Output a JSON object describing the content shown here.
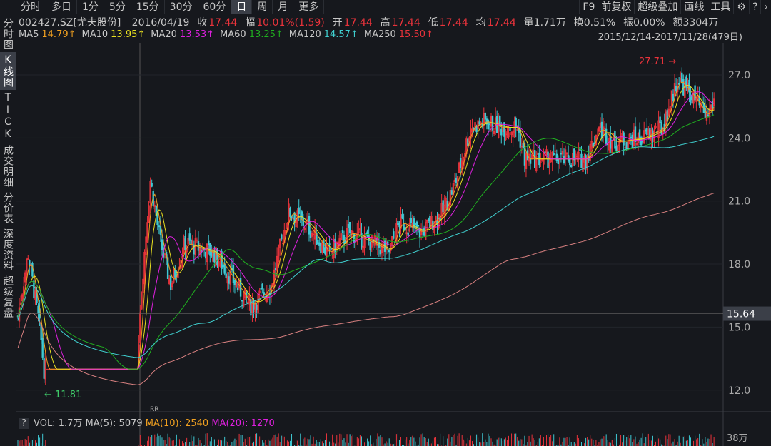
{
  "periods": [
    "分时",
    "多日",
    "1分",
    "5分",
    "15分",
    "30分",
    "60分",
    "日",
    "周",
    "月",
    "更多"
  ],
  "active_period": "日",
  "tools": [
    "F9",
    "前复权",
    "超级叠加",
    "画线",
    "工具",
    "⚙",
    "?",
    "›"
  ],
  "sidebar": [
    "分时图",
    "K线图",
    "TICK",
    "成交明细",
    "分价表",
    "深度资料",
    "超级复盘"
  ],
  "info": {
    "code": "002427.SZ[尤夫股份]",
    "date": "2016/04/19",
    "close_l": "收",
    "close": "17.44",
    "amp_l": "幅",
    "amp": "10.01%(1.59)",
    "open_l": "开",
    "open": "17.44",
    "high_l": "高",
    "high": "17.44",
    "low_l": "低",
    "low": "17.44",
    "avg_l": "均",
    "avg": "17.44",
    "vol": "量1.71万",
    "turn": "换0.51%",
    "swing": "振0.00%",
    "amount": "额3304万"
  },
  "ma": [
    {
      "l": "MA5",
      "v": "14.79↑",
      "c": "#f0a020"
    },
    {
      "l": "MA10",
      "v": "13.95↑",
      "c": "#e8e020"
    },
    {
      "l": "MA20",
      "v": "13.53↑",
      "c": "#e020e0"
    },
    {
      "l": "MA60",
      "v": "13.25↑",
      "c": "#20b020"
    },
    {
      "l": "MA120",
      "v": "14.57↑",
      "c": "#40d0d0"
    },
    {
      "l": "MA250",
      "v": "15.50↑",
      "c": "#e8333b"
    }
  ],
  "range": "2015/12/14-2017/11/28(479日)",
  "axis": {
    "ticks": [
      "27.0",
      "24.0",
      "21.0",
      "18.0",
      "15.0",
      "12.0"
    ],
    "current": "15.64",
    "vol_top": "38万"
  },
  "marks": {
    "high": "27.71",
    "low": "11.81",
    "rr": "RR"
  },
  "vol": {
    "q": "?",
    "vol": "VOL: 1.7万",
    "ma5": "MA(5): 5079",
    "ma10": "MA(10): 2540",
    "ma20": "MA(20): 1270"
  },
  "chart_data": {
    "type": "candlestick",
    "bars": 479,
    "ylim": [
      11.5,
      28
    ],
    "current_price": 15.64,
    "close_keypoints": [
      [
        0,
        15.5
      ],
      [
        7,
        18.5
      ],
      [
        15,
        15
      ],
      [
        18,
        13
      ],
      [
        22,
        13
      ],
      [
        82,
        13
      ],
      [
        84,
        16
      ],
      [
        91,
        22
      ],
      [
        98,
        19
      ],
      [
        105,
        17
      ],
      [
        115,
        19
      ],
      [
        135,
        18.5
      ],
      [
        150,
        17
      ],
      [
        160,
        16
      ],
      [
        174,
        17
      ],
      [
        186,
        20.5
      ],
      [
        199,
        19.8
      ],
      [
        213,
        18.5
      ],
      [
        228,
        19.5
      ],
      [
        243,
        19
      ],
      [
        255,
        18.6
      ],
      [
        262,
        20
      ],
      [
        277,
        19.5
      ],
      [
        292,
        20.5
      ],
      [
        301,
        22
      ],
      [
        311,
        24.5
      ],
      [
        321,
        24.8
      ],
      [
        331,
        24.5
      ],
      [
        343,
        24.5
      ],
      [
        348,
        23
      ],
      [
        390,
        23
      ],
      [
        399,
        24.5
      ],
      [
        409,
        23.8
      ],
      [
        429,
        24
      ],
      [
        443,
        24.5
      ],
      [
        453,
        26.8
      ],
      [
        463,
        26
      ],
      [
        473,
        25
      ],
      [
        478,
        25.8
      ]
    ]
  }
}
